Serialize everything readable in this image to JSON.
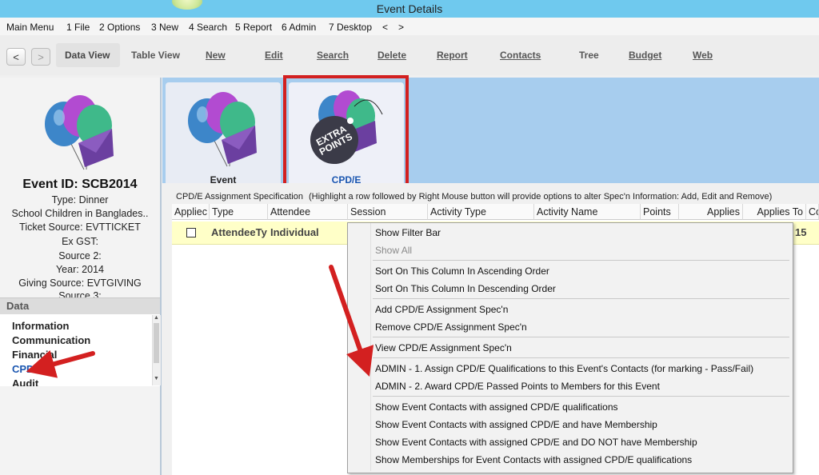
{
  "window": {
    "title": "Event Details"
  },
  "menu": [
    "Main Menu",
    "1 File",
    "2 Options",
    "3 New",
    "4 Search",
    "5 Report",
    "6 Admin",
    "7 Desktop",
    "<",
    ">"
  ],
  "toolbar": {
    "back": "<",
    "forward": ">",
    "data_view": "Data View",
    "table_view": "Table View",
    "new": "New",
    "edit": "Edit",
    "search": "Search",
    "delete": "Delete",
    "report": "Report",
    "contacts": "Contacts",
    "tree": "Tree",
    "budget": "Budget",
    "web": "Web"
  },
  "event": {
    "id": "Event ID: SCB2014",
    "type": "Type: Dinner",
    "name": "School Children in Banglades..",
    "ticket_source": "Ticket Source: EVTTICKET",
    "ex_gst": "Ex GST:",
    "source2": "Source 2:",
    "year": "Year: 2014",
    "giving_source": "Giving Source: EVTGIVING",
    "source3": "Source 3:"
  },
  "data_panel": {
    "header": "Data",
    "items": [
      "Information",
      "Communication",
      "Financial",
      "CPD/E",
      "Audit"
    ]
  },
  "tabs": [
    {
      "label": "Event"
    },
    {
      "label": "CPD/E",
      "badge": "EXTRA POINTS"
    }
  ],
  "grid": {
    "caption": "CPD/E Assignment Specification",
    "hint": "(Highlight a row followed by Right Mouse button will provide options to alter Spec'n Information: Add, Edit and Remove)",
    "columns": [
      "Appliec",
      "Type",
      "Attendee",
      "Session",
      "Activity Type",
      "Activity Name",
      "Points",
      "Applies",
      "Applies To",
      "Co"
    ],
    "rows": [
      {
        "type": "AttendeeTy",
        "attendee": "Individual",
        "applies_to": "15"
      }
    ]
  },
  "context_menu": {
    "items": [
      {
        "label": "Show Filter Bar",
        "enabled": true
      },
      {
        "label": "Show All",
        "enabled": false
      },
      {
        "label": "Sort On This Column In Ascending Order",
        "enabled": true
      },
      {
        "label": "Sort On This Column In Descending Order",
        "enabled": true
      },
      {
        "label": "Add CPD/E Assignment Spec'n",
        "enabled": true
      },
      {
        "label": "Remove CPD/E Assignment Spec'n",
        "enabled": true
      },
      {
        "label": "View CPD/E Assignment Spec'n",
        "enabled": true
      },
      {
        "label": "ADMIN - 1. Assign CPD/E Qualifications to this Event's Contacts (for marking - Pass/Fail)",
        "enabled": true
      },
      {
        "label": "ADMIN - 2. Award CPD/E Passed Points to Members for this Event",
        "enabled": true
      },
      {
        "label": "Show Event Contacts with assigned CPD/E qualifications",
        "enabled": true
      },
      {
        "label": "Show Event Contacts with assigned CPD/E and have Membership",
        "enabled": true
      },
      {
        "label": "Show Event Contacts with assigned CPD/E and DO NOT have Membership",
        "enabled": true
      },
      {
        "label": "Show Memberships for Event Contacts with assigned CPD/E qualifications",
        "enabled": true
      }
    ]
  },
  "colors": {
    "title_bar": "#6fc9ee",
    "tabs_bg": "#a7cdee",
    "highlight": "#d32020",
    "row_selected": "#ffffc8",
    "link_blue": "#1a56b0"
  }
}
